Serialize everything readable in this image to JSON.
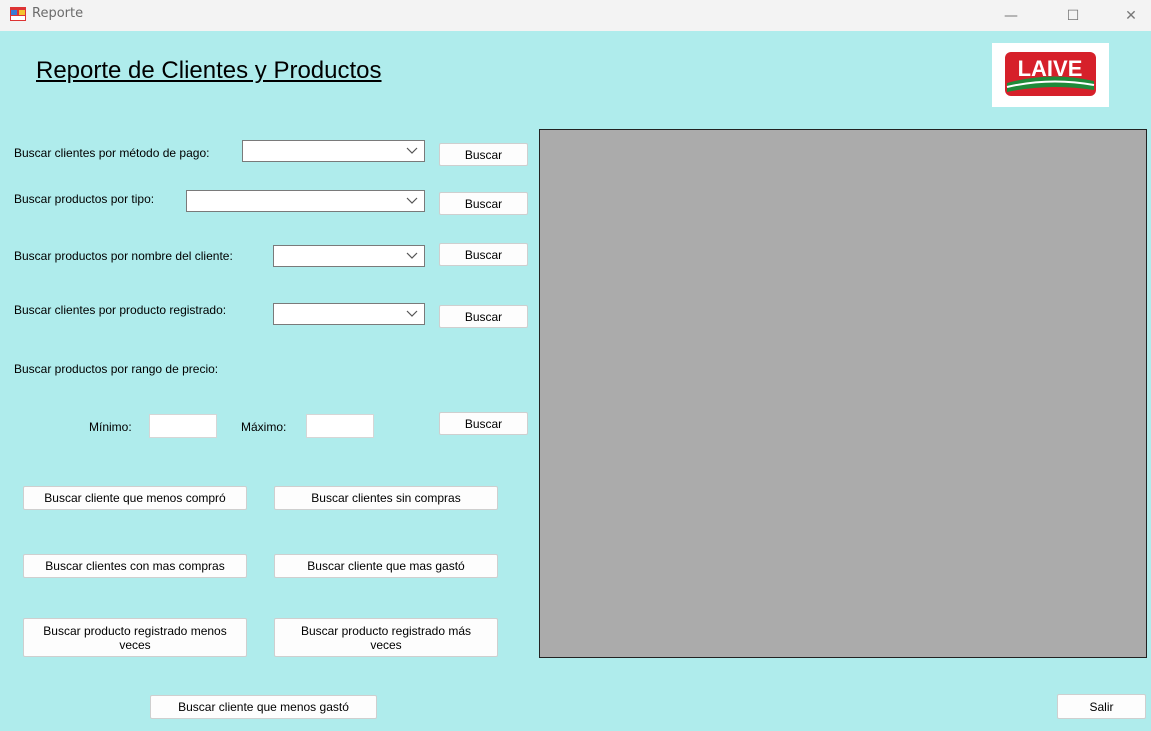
{
  "window": {
    "title": "Reporte",
    "min_glyph": "—",
    "max_glyph": "☐",
    "close_glyph": "✕"
  },
  "page": {
    "title": "Reporte de Clientes y Productos",
    "logo_text": "LAIVE",
    "logo_color": "#d6202a",
    "logo_green": "#1f8a3a"
  },
  "filters": {
    "metodo_pago_label": "Buscar clientes por método de pago:",
    "tipo_label": "Buscar productos por tipo:",
    "nombre_cliente_label": "Buscar productos por nombre del cliente:",
    "producto_registrado_label": "Buscar clientes por producto registrado:",
    "rango_precio_label": "Buscar productos por rango de precio:",
    "minimo_label": "Mínimo:",
    "maximo_label": "Máximo:",
    "minimo_value": "",
    "maximo_value": "",
    "buscar_label": "Buscar",
    "combo_selected": ""
  },
  "actions": {
    "menos_compro": "Buscar cliente que menos compró",
    "sin_compras": "Buscar clientes sin compras",
    "mas_compras": "Buscar clientes con mas compras",
    "mas_gasto": "Buscar cliente que mas gastó",
    "menos_veces": "Buscar producto registrado menos veces",
    "mas_veces": "Buscar producto registrado más veces",
    "menos_gasto": "Buscar cliente que menos gastó",
    "salir": "Salir"
  }
}
